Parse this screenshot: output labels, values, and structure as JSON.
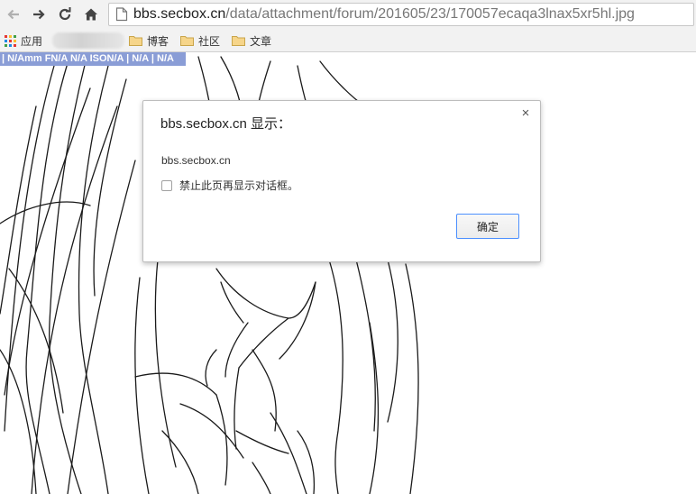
{
  "browser": {
    "url_host": "bbs.secbox.cn",
    "url_path": "/data/attachment/forum/201605/23/170057ecaqa3lnax5xr5hl.jpg",
    "nav_icons": [
      "back-arrow-icon",
      "forward-arrow-icon",
      "reload-icon",
      "home-icon"
    ]
  },
  "bookmarks": {
    "apps_label": "应用",
    "items": [
      {
        "label": "博客",
        "icon": "folder-icon"
      },
      {
        "label": "社区",
        "icon": "folder-icon"
      },
      {
        "label": "文章",
        "icon": "folder-icon"
      }
    ]
  },
  "page": {
    "meta_strip": "| N/Amm FN/A N/A ISON/A | N/A | N/A"
  },
  "dialog": {
    "title": "bbs.secbox.cn 显示：",
    "message": "bbs.secbox.cn",
    "checkbox_label": "禁止此页再显示对话框。",
    "checkbox_checked": false,
    "ok_label": "确定",
    "close_glyph": "×"
  },
  "colors": {
    "toolbar_bg": "#f2f2f2",
    "meta_strip_bg": "#8a9dd6",
    "button_focus_border": "#4d90fe"
  }
}
